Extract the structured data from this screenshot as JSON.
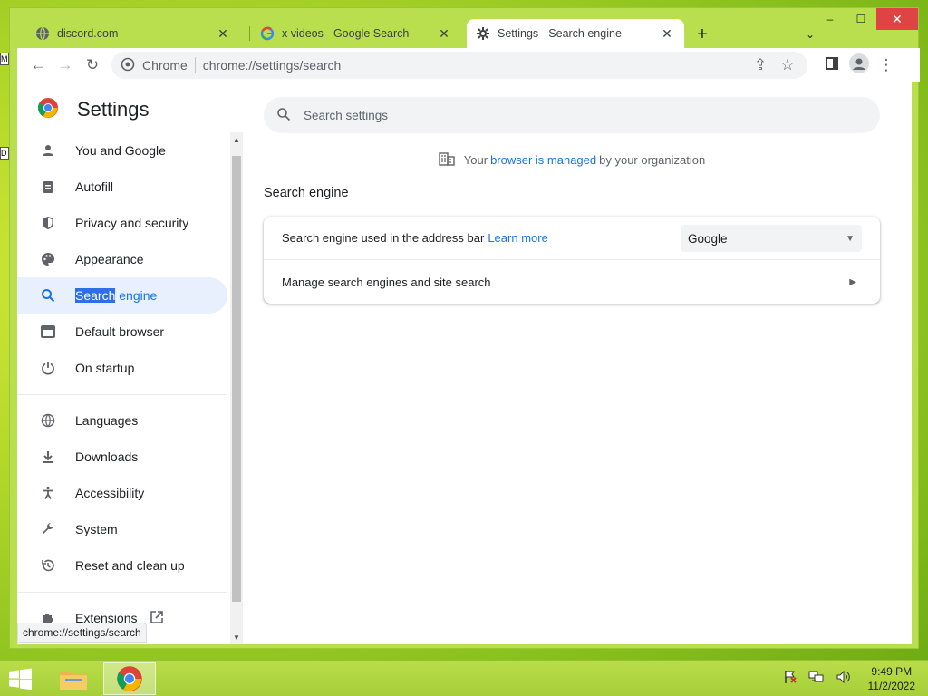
{
  "window": {
    "minimize": "–",
    "maximize": "☐",
    "close": "✕"
  },
  "tabs": [
    {
      "title": "discord.com",
      "icon": "globe-icon"
    },
    {
      "title": "x videos - Google Search",
      "icon": "google-g-icon"
    },
    {
      "title": "Settings - Search engine",
      "icon": "gear-icon"
    }
  ],
  "tabbar": {
    "new_tab": "+",
    "search_tabs": "⌄"
  },
  "omnibox": {
    "chip": "Chrome",
    "url": "chrome://settings/search"
  },
  "settings": {
    "title": "Settings",
    "nav": [
      {
        "label": "You and Google",
        "icon": "person-icon"
      },
      {
        "label": "Autofill",
        "icon": "clipboard-icon"
      },
      {
        "label": "Privacy and security",
        "icon": "shield-icon"
      },
      {
        "label": "Appearance",
        "icon": "palette-icon"
      },
      {
        "label_sel": "Search",
        "label_rest": " engine",
        "icon": "search-icon"
      },
      {
        "label": "Default browser",
        "icon": "browser-window-icon"
      },
      {
        "label": "On startup",
        "icon": "power-icon"
      },
      {
        "label": "Languages",
        "icon": "globe-icon"
      },
      {
        "label": "Downloads",
        "icon": "download-icon"
      },
      {
        "label": "Accessibility",
        "icon": "accessibility-icon"
      },
      {
        "label": "System",
        "icon": "wrench-icon"
      },
      {
        "label": "Reset and clean up",
        "icon": "history-icon"
      },
      {
        "label": "Extensions",
        "icon": "puzzle-icon"
      }
    ],
    "status_url": "chrome://settings/search",
    "search_placeholder": "Search settings",
    "managed": {
      "pre": "Your",
      "link": "browser is managed",
      "post": "by your organization"
    },
    "section_title": "Search engine",
    "rows": {
      "engine_label": "Search engine used in the address bar",
      "learn_more": "Learn more",
      "engine_value": "Google",
      "manage_label": "Manage search engines and site search"
    }
  },
  "taskbar": {
    "time": "9:49 PM",
    "date": "11/2/2022"
  },
  "colors": {
    "accent": "#1a73e8",
    "active_nav_bg": "#e8f0fe",
    "frame": "#b9df4e"
  }
}
